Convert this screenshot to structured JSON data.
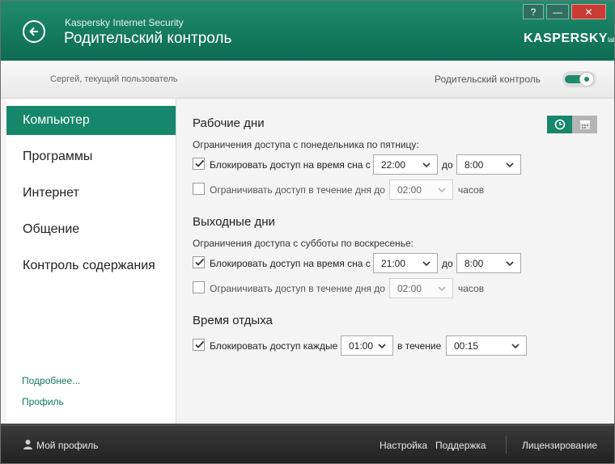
{
  "header": {
    "app_name": "Kaspersky Internet Security",
    "title": "Родительский контроль",
    "brand": "KASPERSKY",
    "brand_suffix": "lab",
    "help_label": "?",
    "minimize_label": "—",
    "close_label": "✕"
  },
  "subheader": {
    "user_text": "Сергей, текущий пользователь",
    "pc_label": "Родительский контроль",
    "pc_enabled": true
  },
  "sidebar": {
    "items": [
      {
        "label": "Компьютер",
        "active": true
      },
      {
        "label": "Программы",
        "active": false
      },
      {
        "label": "Интернет",
        "active": false
      },
      {
        "label": "Общение",
        "active": false
      },
      {
        "label": "Контроль содержания",
        "active": false
      }
    ],
    "more_link": "Подробнее...",
    "profile_link": "Профиль"
  },
  "main": {
    "workdays": {
      "title": "Рабочие дни",
      "desc": "Ограничения доступа с понедельника по пятницу:",
      "sleep": {
        "checked": true,
        "label": "Блокировать доступ на время сна с",
        "from": "22:00",
        "to_label": "до",
        "to": "8:00"
      },
      "daily": {
        "checked": false,
        "label": "Ограничивать доступ в течение дня до",
        "value": "02:00",
        "unit": "часов"
      }
    },
    "weekend": {
      "title": "Выходные дни",
      "desc": "Ограничения доступа с субботы по воскресенье:",
      "sleep": {
        "checked": true,
        "label": "Блокировать доступ на время сна с",
        "from": "21:00",
        "to_label": "до",
        "to": "8:00"
      },
      "daily": {
        "checked": false,
        "label": "Ограничивать доступ в течение дня до",
        "value": "02:00",
        "unit": "часов"
      }
    },
    "rest": {
      "title": "Время отдыха",
      "block": {
        "checked": true,
        "label": "Блокировать доступ каждые",
        "every": "01:00",
        "during_label": "в течение",
        "during": "00:15"
      }
    }
  },
  "footer": {
    "profile": "Мой профиль",
    "settings": "Настройка",
    "support": "Поддержка",
    "licensing": "Лицензирование"
  },
  "colors": {
    "accent": "#16876a",
    "header": "#0d6b52",
    "close": "#c93b34",
    "footer": "#2b2b2b"
  },
  "icons": [
    "back-arrow-icon",
    "profile-icon",
    "clock-icon",
    "calendar-icon",
    "chevron-down-icon",
    "checkmark-icon"
  ]
}
